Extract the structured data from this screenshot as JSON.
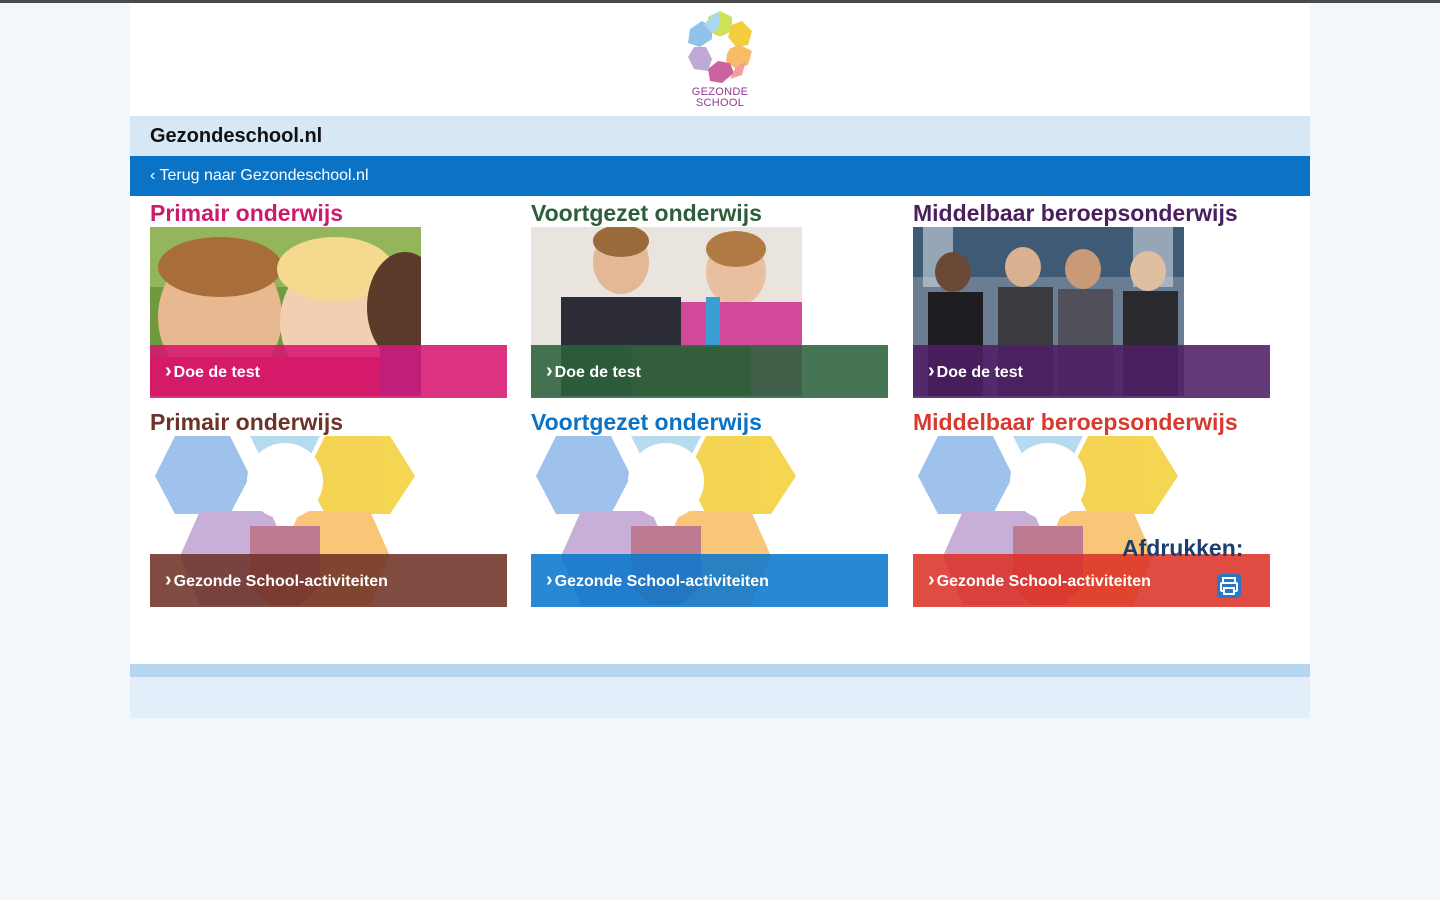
{
  "logo": {
    "line1": "GEZONDE",
    "line2": "SCHOOL"
  },
  "site": {
    "title": "Gezondeschool.nl"
  },
  "nav": {
    "back_link": "‹ Terug naar Gezondeschool.nl"
  },
  "colors": {
    "primair_pink": "#cc1a6e",
    "voortgezet_green": "#2e5d3b",
    "mbo_purple": "#4a1f5e",
    "primair_brown": "#6e3328",
    "voortgezet_blue": "#0a73c5",
    "mbo_red": "#d83a2e"
  },
  "tiles": [
    {
      "title": "Primair onderwijs",
      "button": "Doe de test",
      "image": "children-photo"
    },
    {
      "title": "Voortgezet onderwijs",
      "button": "Doe de test",
      "image": "students-cooking-photo"
    },
    {
      "title": "Middelbaar beroepsonderwijs",
      "button": "Doe de test",
      "image": "teens-photo"
    },
    {
      "title": "Primair onderwijs",
      "button": "Gezonde School-activiteiten",
      "image": "flower-logo"
    },
    {
      "title": "Voortgezet onderwijs",
      "button": "Gezonde School-activiteiten",
      "image": "flower-logo"
    },
    {
      "title": "Middelbaar beroepsonderwijs",
      "button": "Gezonde School-activiteiten",
      "image": "flower-logo"
    }
  ],
  "print": {
    "label": "Afdrukken:",
    "icon": "printer-icon"
  }
}
